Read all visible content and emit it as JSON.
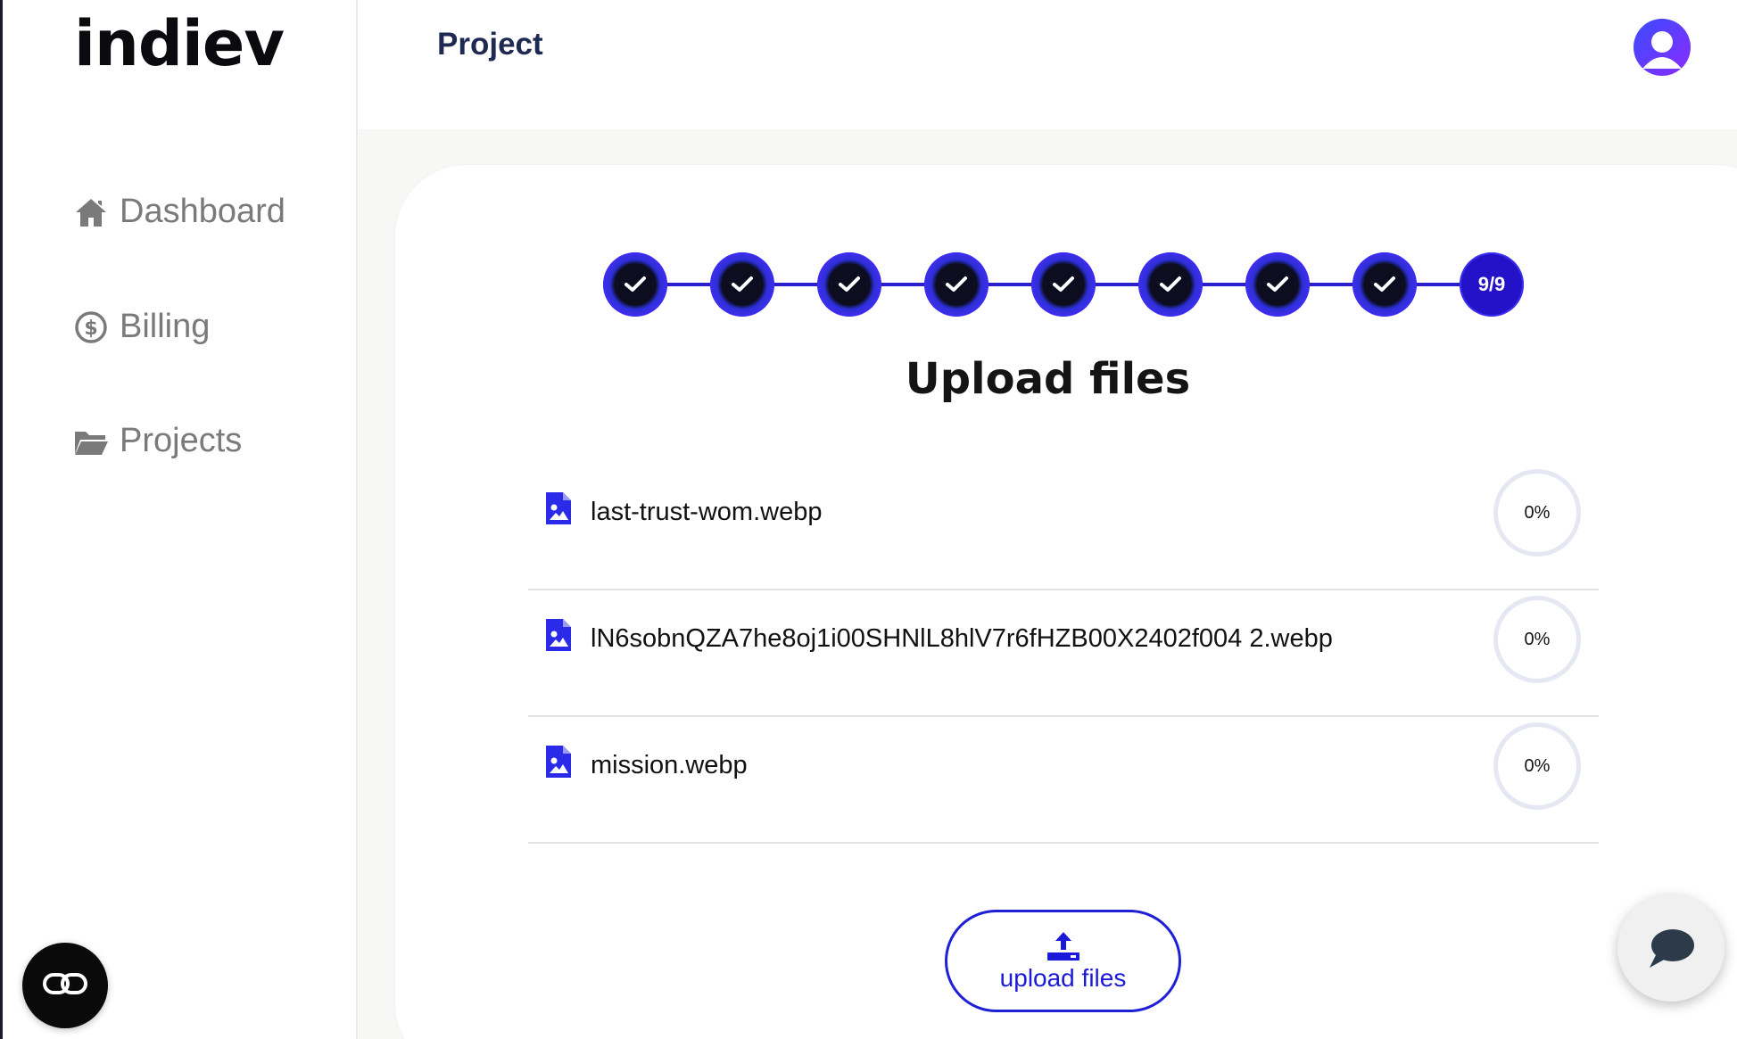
{
  "brand": {
    "logo_text": "indiev"
  },
  "header": {
    "title": "Project"
  },
  "sidebar": {
    "items": [
      {
        "label": "Dashboard",
        "icon": "home-icon"
      },
      {
        "label": "Billing",
        "icon": "dollar-circle-icon"
      },
      {
        "label": "Projects",
        "icon": "folder-open-icon"
      }
    ]
  },
  "stepper": {
    "total_steps": 9,
    "completed_steps": 8,
    "current_label": "9/9"
  },
  "main": {
    "title": "Upload files",
    "files": [
      {
        "name": "last-trust-wom.webp",
        "progress_label": "0%",
        "progress": 0,
        "icon": "image-file-icon"
      },
      {
        "name": "lN6sobnQZA7he8oj1i00SHNlL8hlV7r6fHZB00X2402f004 2.webp",
        "progress_label": "0%",
        "progress": 0,
        "icon": "image-file-icon"
      },
      {
        "name": "mission.webp",
        "progress_label": "0%",
        "progress": 0,
        "icon": "image-file-icon"
      }
    ],
    "upload_button_label": "upload files"
  },
  "colors": {
    "accent": "#1f1fd6",
    "step_fill": "#2412c9",
    "header_text": "#1f2a52",
    "sidebar_text": "#7a7a7a"
  }
}
